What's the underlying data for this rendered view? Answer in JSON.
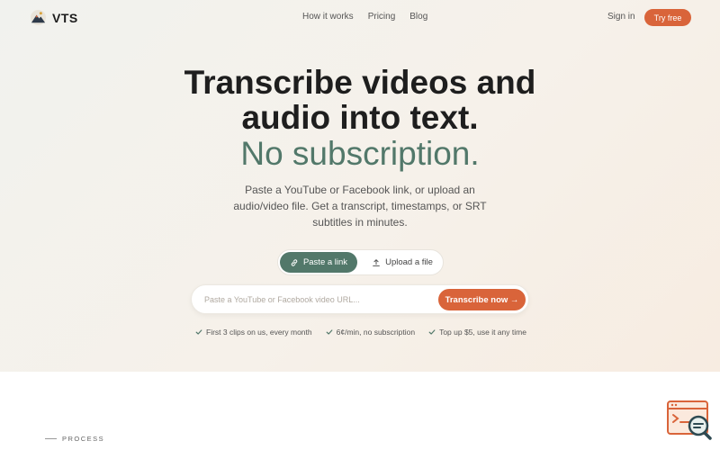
{
  "nav": {
    "brand": "VTS",
    "links": [
      "How it works",
      "Pricing",
      "Blog"
    ],
    "signin": "Sign in",
    "try_free": "Try free"
  },
  "hero": {
    "title_line1": "Transcribe videos and",
    "title_line2": "audio into text.",
    "title_accent": "No subscription.",
    "subtitle": "Paste a YouTube or Facebook link, or upload an audio/video file. Get a transcript, timestamps, or SRT subtitles in minutes."
  },
  "toggle": {
    "paste_label": "Paste a link",
    "upload_label": "Upload a file",
    "active": "paste"
  },
  "url": {
    "placeholder": "Paste a YouTube or Facebook video URL...",
    "value": "",
    "cta": "Transcribe now →"
  },
  "features": [
    "First 3 clips on us, every month",
    "6¢/min, no subscription",
    "Top up $5, use it any time"
  ],
  "section": {
    "label": "PROCESS"
  },
  "colors": {
    "accent_orange": "#d9643a",
    "accent_green": "#52786a",
    "text_dark": "#1e1e1e"
  },
  "icons": {
    "logo": "mountain-logo-icon",
    "paste": "link-icon",
    "upload": "upload-icon",
    "check": "check-icon",
    "widget": "browser-search-icon"
  }
}
